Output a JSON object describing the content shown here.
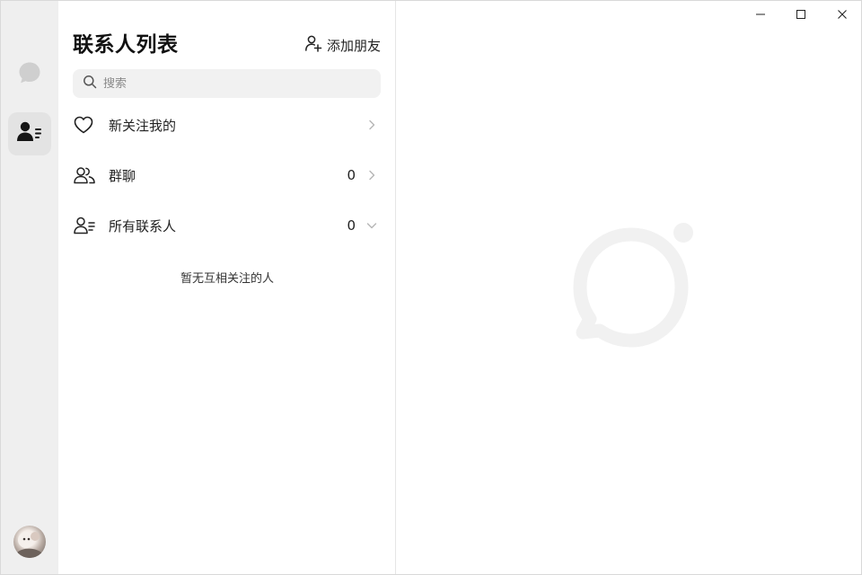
{
  "rail": {
    "items": [
      {
        "icon": "chat-bubble-icon",
        "active": false
      },
      {
        "icon": "contacts-icon",
        "active": true
      }
    ],
    "avatar": "user-avatar"
  },
  "contacts": {
    "title": "联系人列表",
    "add_friend_label": "添加朋友",
    "search_placeholder": "搜索",
    "rows": [
      {
        "label": "新关注我的",
        "count": "",
        "icon": "heart-icon",
        "chevron": "chevron-right-icon"
      },
      {
        "label": "群聊",
        "count": "0",
        "icon": "group-icon",
        "chevron": "chevron-right-icon"
      },
      {
        "label": "所有联系人",
        "count": "0",
        "icon": "contact-list-icon",
        "chevron": "chevron-down-icon"
      }
    ],
    "empty_text": "暂无互相关注的人"
  },
  "window_controls": [
    "minimize",
    "maximize",
    "close"
  ],
  "colors": {
    "rail_bg": "#efefef",
    "rail_active_bg": "#e3e3e3",
    "search_bg": "#f1f1f1",
    "watermark": "#f0f0f0",
    "text": "#1f1f1f"
  }
}
